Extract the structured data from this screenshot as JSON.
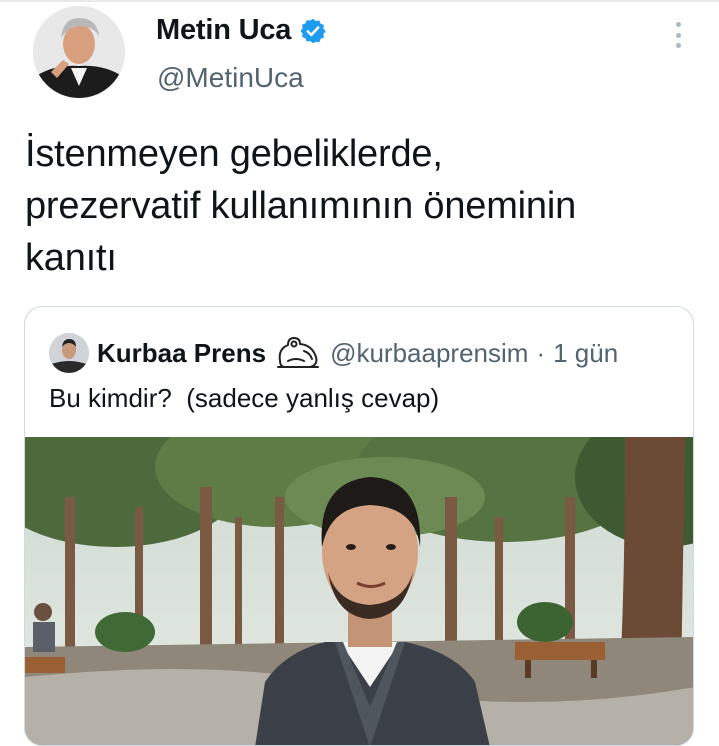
{
  "author": {
    "name": "Metin Uca",
    "handle": "@MetinUca",
    "verified_icon": "verified-badge-icon",
    "verified_color": "#1d9bf0"
  },
  "tweet": {
    "text": "İstenmeyen gebeliklerde,\nprezervatif kullanımının öneminin\nkanıtı"
  },
  "quote": {
    "name": "Kurbaa Prens",
    "emoji_icon": "frog-icon",
    "handle": "@kurbaaprensim",
    "separator": "·",
    "time": "1 gün",
    "text": "Bu kimdir?  (sadece yanlış cevap)"
  },
  "more_icon": "more-vertical-icon",
  "colors": {
    "text": "#0f1419",
    "secondary": "#536471",
    "border": "#cfd9de"
  }
}
